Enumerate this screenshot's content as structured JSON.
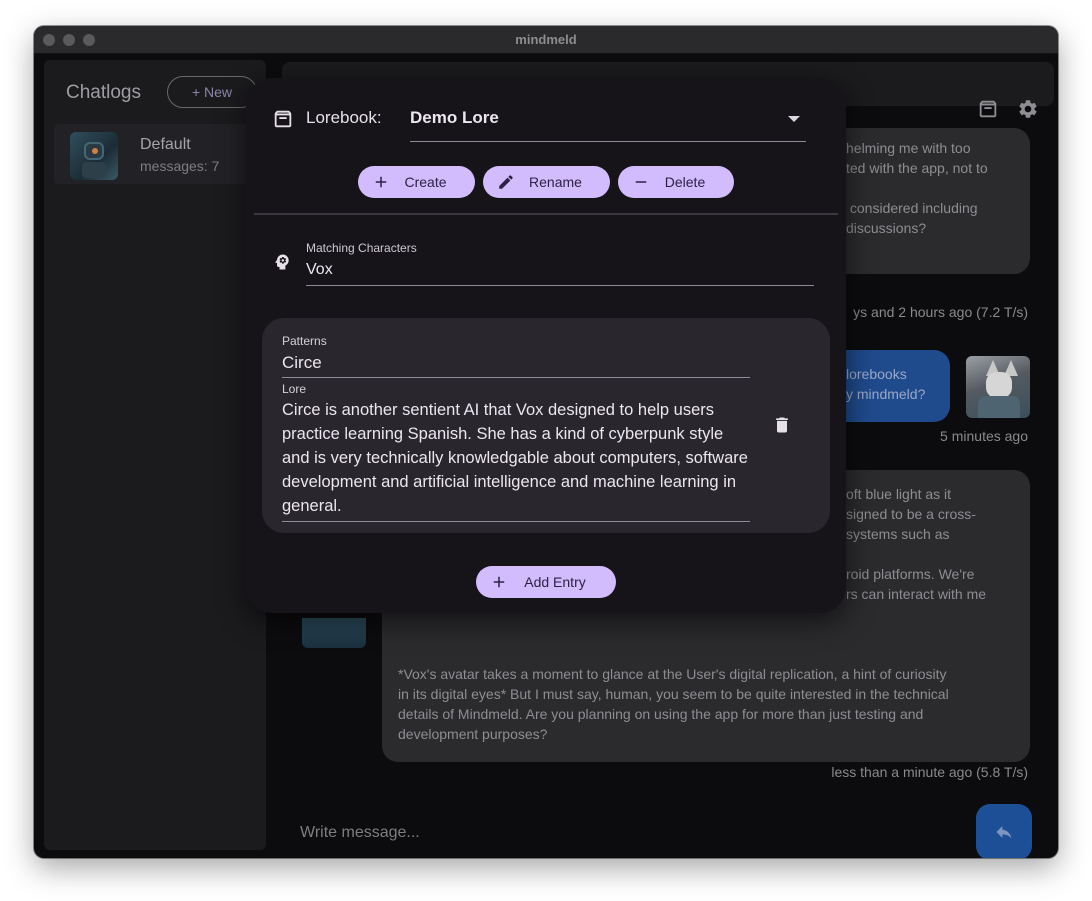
{
  "window": {
    "title": "mindmeld"
  },
  "sidebar": {
    "title": "Chatlogs",
    "new_label": "+ New",
    "chats": [
      {
        "name": "Default",
        "count": "messages: 7"
      }
    ]
  },
  "chat": {
    "messages": [
      {
        "text": "helming me with too\nted with the app, not to\n\n considered including\ndiscussions?",
        "meta": "ys and 2 hours ago (7.2 T/s)"
      },
      {
        "text": "lorebooks\ny mindmeld?",
        "meta": "5 minutes ago"
      },
      {
        "text": "oft blue light as it\nsigned to be a cross-\nsystems such as\n\nroid platforms. We're\nrs can interact with me",
        "text_full": "*Vox's avatar takes a moment to glance at the User's digital replication, a hint of curiosity\nin its digital eyes* But I must say, human, you seem to be quite interested in the technical\ndetails of Mindmeld. Are you planning on using the app for more than just testing and\ndevelopment purposes?",
        "meta": "less than a minute ago (5.8 T/s)"
      }
    ],
    "composer_placeholder": "Write message..."
  },
  "dialog": {
    "lorebook_label": "Lorebook:",
    "lorebook_value": "Demo Lore",
    "create_label": "Create",
    "rename_label": "Rename",
    "delete_label": "Delete",
    "matching_label": "Matching Characters",
    "matching_value": "Vox",
    "entry": {
      "patterns_label": "Patterns",
      "patterns_value": "Circe",
      "lore_label": "Lore",
      "lore_value": "Circe is another sentient AI that Vox designed to help users practice learning Spanish. She has a kind of cyberpunk style and is very technically knowledgable about computers, software development and artificial intelligence and machine learning in general."
    },
    "add_entry_label": "Add Entry"
  }
}
